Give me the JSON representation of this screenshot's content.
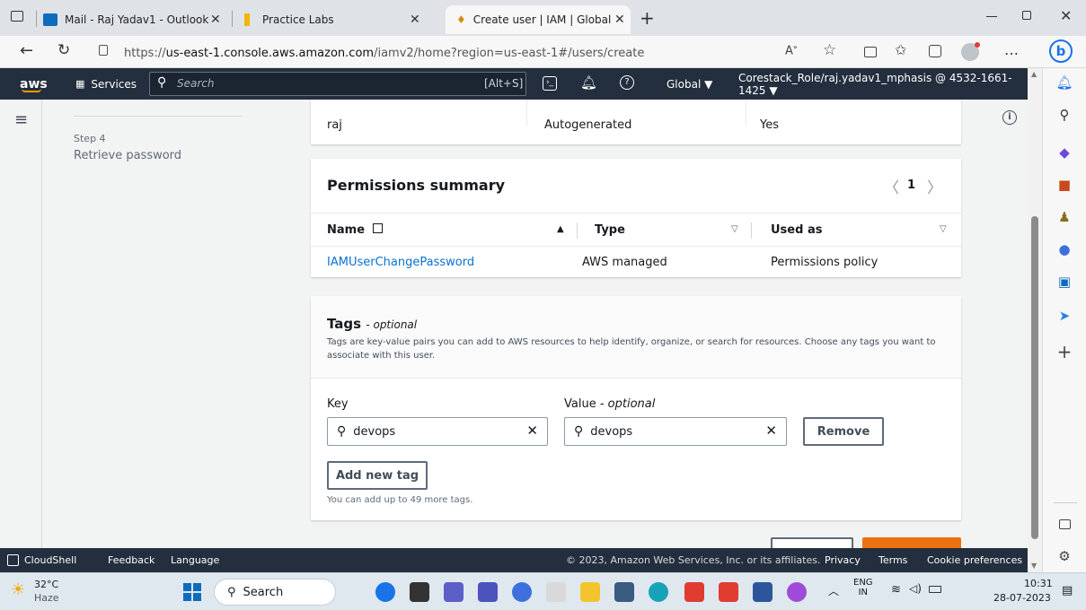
{
  "browser": {
    "tabs": [
      {
        "label": "Mail - Raj Yadav1 - Outlook"
      },
      {
        "label": "Practice Labs"
      },
      {
        "label": "Create user | IAM | Global"
      }
    ],
    "url_prefix": "https://",
    "url_host": "us-east-1.console.aws.amazon.com",
    "url_path": "/iamv2/home?region=us-east-1#/users/create"
  },
  "aws_header": {
    "logo": "aws",
    "services": "Services",
    "search_placeholder": "Search",
    "search_shortcut": "[Alt+S]",
    "region": "Global ▼",
    "account": "Corestack_Role/raj.yadav1_mphasis @ 4532-1661-1425 ▼"
  },
  "left_steps": {
    "step_label": "Step 4",
    "step_title": "Retrieve password"
  },
  "user_details_row": {
    "username": "raj",
    "password": "Autogenerated",
    "reset": "Yes"
  },
  "permissions": {
    "title": "Permissions summary",
    "page": "1",
    "columns": [
      "Name",
      "Type",
      "Used as"
    ],
    "rows": [
      {
        "name": "IAMUserChangePassword",
        "type": "AWS managed",
        "used_as": "Permissions policy"
      }
    ]
  },
  "tags": {
    "title": "Tags",
    "title_optional": "- optional",
    "description_line1": "Tags are key-value pairs you can add to AWS resources to help identify, organize, or search for resources. Choose any tags you want to",
    "description_line2": "associate with this user.",
    "key_label": "Key",
    "value_label": "Value",
    "value_optional": "- optional",
    "key_value": "devops",
    "value_value": "devops",
    "remove": "Remove",
    "add_new": "Add new tag",
    "hint": "You can add up to 49 more tags."
  },
  "footer": {
    "cloudshell": "CloudShell",
    "feedback": "Feedback",
    "language": "Language",
    "copyright": "© 2023, Amazon Web Services, Inc. or its affiliates.",
    "privacy": "Privacy",
    "terms": "Terms",
    "cookies": "Cookie preferences"
  },
  "taskbar": {
    "temp": "32°C",
    "weather": "Haze",
    "search": "Search",
    "lang1": "ENG",
    "lang2": "IN",
    "time": "10:31",
    "date": "28-07-2023"
  },
  "colors": {
    "aws_nav": "#232f3e",
    "link": "#0972d3",
    "primary": "#ec7211"
  }
}
